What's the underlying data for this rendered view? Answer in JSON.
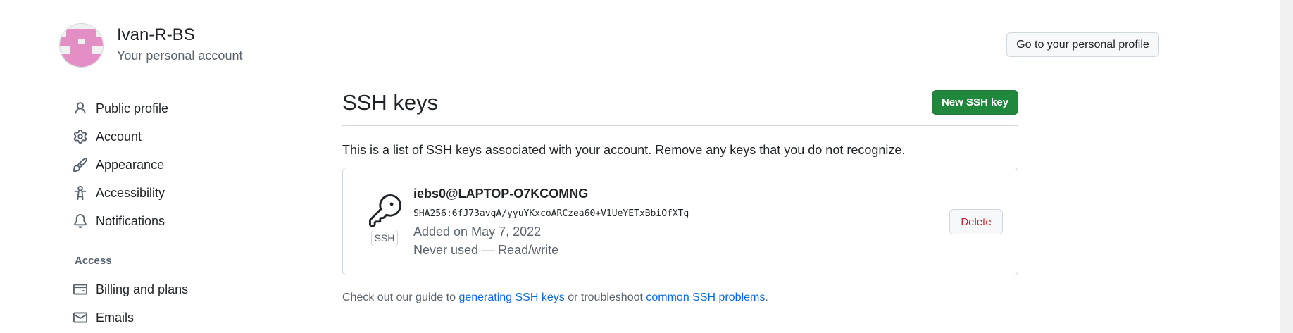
{
  "account": {
    "name": "Ivan-R-BS",
    "subtitle": "Your personal account",
    "profile_button": "Go to your personal profile"
  },
  "sidebar": {
    "items": [
      {
        "label": "Public profile",
        "icon": "person-icon"
      },
      {
        "label": "Account",
        "icon": "gear-icon"
      },
      {
        "label": "Appearance",
        "icon": "paintbrush-icon"
      },
      {
        "label": "Accessibility",
        "icon": "accessibility-icon"
      },
      {
        "label": "Notifications",
        "icon": "bell-icon"
      }
    ],
    "access_heading": "Access",
    "access_items": [
      {
        "label": "Billing and plans",
        "icon": "credit-card-icon"
      },
      {
        "label": "Emails",
        "icon": "mail-icon"
      }
    ]
  },
  "main": {
    "title": "SSH keys",
    "new_key_button": "New SSH key",
    "intro": "This is a list of SSH keys associated with your account. Remove any keys that you do not recognize.",
    "keys": [
      {
        "title": "iebs0@LAPTOP-O7KCOMNG",
        "fingerprint": "SHA256:6fJ73avgA/yyuYKxcoARCzea60+V1UeYETxBbiOfXTg",
        "added": "Added on May 7, 2022",
        "usage": "Never used — Read/write",
        "badge": "SSH",
        "delete_label": "Delete"
      }
    ],
    "footer": {
      "prefix": "Check out our guide to ",
      "link1": "generating SSH keys",
      "middle": " or troubleshoot ",
      "link2": "common SSH problems",
      "suffix": "."
    }
  },
  "colors": {
    "primary_button": "#1f883d",
    "danger": "#cf222e",
    "link": "#0969da",
    "avatar": "#e48ec6"
  }
}
